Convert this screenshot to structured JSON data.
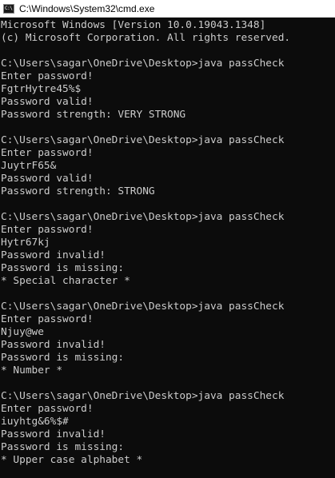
{
  "window": {
    "title": "C:\\Windows\\System32\\cmd.exe",
    "icon": "cmd-icon"
  },
  "console": {
    "lines": [
      "Microsoft Windows [Version 10.0.19043.1348]",
      "(c) Microsoft Corporation. All rights reserved.",
      "",
      "C:\\Users\\sagar\\OneDrive\\Desktop>java passCheck",
      "Enter password!",
      "FgtrHytre45%$",
      "Password valid!",
      "Password strength: VERY STRONG",
      "",
      "C:\\Users\\sagar\\OneDrive\\Desktop>java passCheck",
      "Enter password!",
      "JuytrF65&",
      "Password valid!",
      "Password strength: STRONG",
      "",
      "C:\\Users\\sagar\\OneDrive\\Desktop>java passCheck",
      "Enter password!",
      "Hytr67kj",
      "Password invalid!",
      "Password is missing:",
      "* Special character *",
      "",
      "C:\\Users\\sagar\\OneDrive\\Desktop>java passCheck",
      "Enter password!",
      "Njuy@we",
      "Password invalid!",
      "Password is missing:",
      "* Number *",
      "",
      "C:\\Users\\sagar\\OneDrive\\Desktop>java passCheck",
      "Enter password!",
      "iuyhtg&6%$#",
      "Password invalid!",
      "Password is missing:",
      "* Upper case alphabet *"
    ]
  },
  "colors": {
    "background": "#0c0c0c",
    "text": "#cccccc",
    "titlebar": "#ffffff"
  }
}
